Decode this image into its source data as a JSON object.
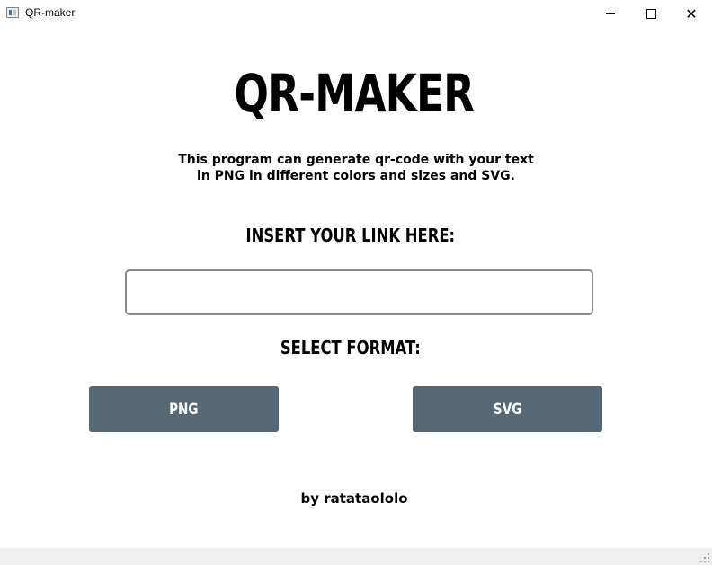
{
  "window": {
    "title": "QR-maker",
    "minimize_icon": "minimize-icon",
    "maximize_icon": "maximize-icon",
    "close_icon": "close-icon",
    "close_glyph": "✕"
  },
  "main": {
    "title": "QR-MAKER",
    "description_line1": "This program can generate qr-code with your text",
    "description_line2": "in PNG in different colors and sizes and SVG.",
    "link_label": "INSERT YOUR LINK HERE:",
    "link_value": "",
    "link_placeholder": "",
    "format_label": "SELECT FORMAT:",
    "png_button": "PNG",
    "svg_button": "SVG",
    "author": "by ratataololo"
  },
  "colors": {
    "button_bg": "#566874",
    "button_text": "#ffffff",
    "input_border": "#8a8a8a",
    "statusbar_bg": "#f0f0f0"
  }
}
